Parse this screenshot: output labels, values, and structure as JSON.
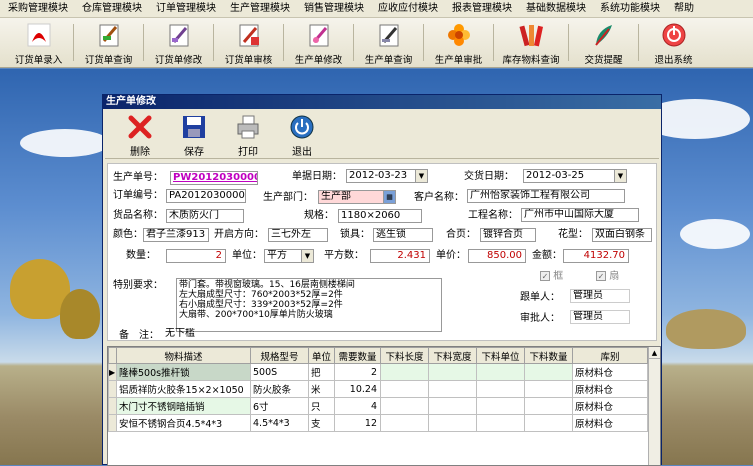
{
  "menu": [
    "采购管理模块",
    "仓库管理模块",
    "订单管理模块",
    "生产管理模块",
    "销售管理模块",
    "应收应付模块",
    "报表管理模块",
    "基础数据模块",
    "系统功能模块",
    "帮助"
  ],
  "toolbar": [
    {
      "label": "订货单录入",
      "icon": "adobe-icon"
    },
    {
      "label": "订货单查询",
      "icon": "pen-doc-icon"
    },
    {
      "label": "订货单修改",
      "icon": "pen-doc-icon"
    },
    {
      "label": "订货单审核",
      "icon": "doc-check-icon"
    },
    {
      "label": "生产单修改",
      "icon": "pen-doc-icon"
    },
    {
      "label": "生产单查询",
      "icon": "pen-doc-icon"
    },
    {
      "label": "生产单审批",
      "icon": "flower-icon"
    },
    {
      "label": "库存物料查询",
      "icon": "books-icon"
    },
    {
      "label": "交货提醒",
      "icon": "feather-icon"
    },
    {
      "label": "退出系统",
      "icon": "exit-icon"
    }
  ],
  "window": {
    "title": "生产单修改"
  },
  "wtools": [
    {
      "label": "删除"
    },
    {
      "label": "保存"
    },
    {
      "label": "打印"
    },
    {
      "label": "退出"
    }
  ],
  "form": {
    "order_no_label": "生产单号：",
    "order_no": "PW20120300001",
    "date_label": "单据日期：",
    "date": "2012-03-23",
    "delivery_label": "交货日期：",
    "delivery": "2012-03-25",
    "orderno_label": "订单编号：",
    "orderno": "PA20120300001",
    "dept_label": "生产部门：",
    "dept": "生产部",
    "customer_label": "客户名称：",
    "customer": "广州怡家装饰工程有限公司",
    "goods_label": "货品名称：",
    "goods": "木质防火门",
    "spec_label": "规格：",
    "spec": "1180×2060",
    "project_label": "工程名称：",
    "project": "广州市中山国际大厦",
    "color_label": "颜色：",
    "color": "君子兰漆913",
    "open_label": "开启方向：",
    "open": "三七外左",
    "lock_label": "锁具：",
    "lock": "逃生锁",
    "hinge_label": "合页：",
    "hinge": "镀锌合页",
    "pattern_label": "花型：",
    "pattern": "双面白钢条",
    "qty_label": "数量：",
    "qty": "2",
    "unit_label": "单位：",
    "unit": "平方",
    "area_label": "平方数：",
    "area": "2.431",
    "price_label": "单价：",
    "price": "850.00",
    "amount_label": "金额：",
    "amount": "4132.70",
    "special_label": "特别要求：",
    "special": [
      "带门套。带视窗玻璃。15、16层南侧楼梯间",
      "左大扇成型尺寸：760*2003*52厚=2件",
      "右小扇成型尺寸：339*2003*52厚=2件",
      "大扇带、200*700*10厚单片防火玻璃"
    ],
    "frame_label": "框",
    "fan_label": "扇",
    "follower_label": "跟单人：",
    "follower": "管理员",
    "approver_label": "审批人：",
    "approver": "管理员",
    "remark_label": "备　注：",
    "remark": "无下槛"
  },
  "grid": {
    "headers": [
      "物料描述",
      "规格型号",
      "单位",
      "需要数量",
      "下料长度",
      "下料宽度",
      "下料单位",
      "下料数量",
      "库别"
    ],
    "rows": [
      [
        "隆棒500s推杆锁",
        "500S",
        "把",
        "2",
        "",
        "",
        "",
        "",
        "原材料仓"
      ],
      [
        "铝质祥防火胶条15×2×1050",
        "防火胶条",
        "米",
        "10.24",
        "",
        "",
        "",
        "",
        "原材料仓"
      ],
      [
        "木门寸不锈钢暗插销",
        "6寸",
        "只",
        "4",
        "",
        "",
        "",
        "",
        "原材料仓"
      ],
      [
        "安恒不锈钢合页4.5*4*3",
        "4.5*4*3",
        "支",
        "12",
        "",
        "",
        "",
        "",
        "原材料仓"
      ]
    ],
    "row_marker": "▶"
  },
  "colors": {
    "accent": "#0a246a",
    "red": "#c00000",
    "blue_text": "#0000c0",
    "dept_bg": "#ffd8d8"
  }
}
